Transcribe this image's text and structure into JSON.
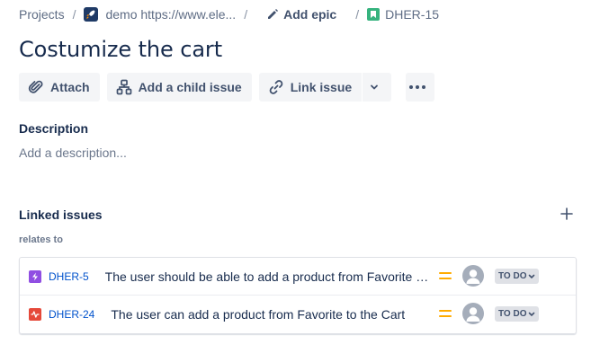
{
  "breadcrumb": {
    "projects": "Projects",
    "separator": "/",
    "project_name": "demo https://www.ele...",
    "add_epic": "Add epic",
    "issue_key": "DHER-15"
  },
  "issue": {
    "title": "Costumize the cart"
  },
  "toolbar": {
    "attach": "Attach",
    "add_child": "Add a child issue",
    "link_issue": "Link issue"
  },
  "description": {
    "label": "Description",
    "placeholder": "Add a description..."
  },
  "linked_issues": {
    "label": "Linked issues",
    "relation": "relates to",
    "items": [
      {
        "type": "epic",
        "type_color": "#904ee2",
        "key": "DHER-5",
        "summary": "The user should be able to add a product from Favorite to the Cart",
        "priority": "medium",
        "status": "TO DO"
      },
      {
        "type": "bug",
        "type_color": "#e5493a",
        "key": "DHER-24",
        "summary": "The user can add a product from Favorite to the Cart",
        "priority": "medium",
        "status": "TO DO"
      }
    ]
  },
  "colors": {
    "link_blue": "#0052cc",
    "priority_medium": "#ffab00",
    "button_bg": "#f4f5f7",
    "story_green": "#36b37e"
  }
}
